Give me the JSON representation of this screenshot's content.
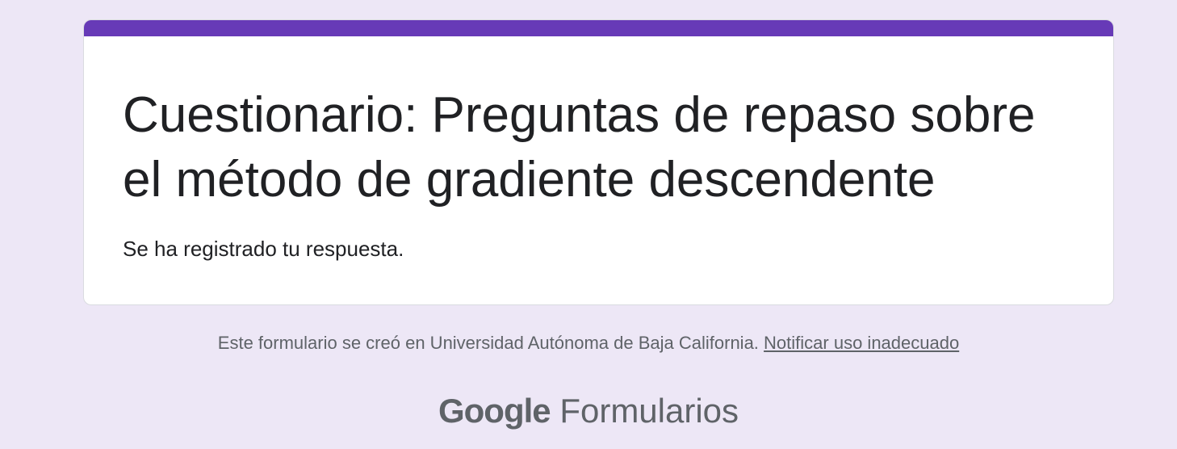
{
  "form": {
    "title": "Cuestionario: Preguntas de repaso sobre el método de gradiente descendente",
    "confirmation_message": "Se ha registrado tu respuesta."
  },
  "footer": {
    "created_in_text": "Este formulario se creó en Universidad Autónoma de Baja California.",
    "report_link": "Notificar uso inadecuado"
  },
  "branding": {
    "google": "Google",
    "product": "Formularios"
  },
  "colors": {
    "page_background": "#ede7f6",
    "accent": "#673ab7",
    "card_background": "#ffffff",
    "text_primary": "#202124",
    "text_secondary": "#5f6368"
  }
}
